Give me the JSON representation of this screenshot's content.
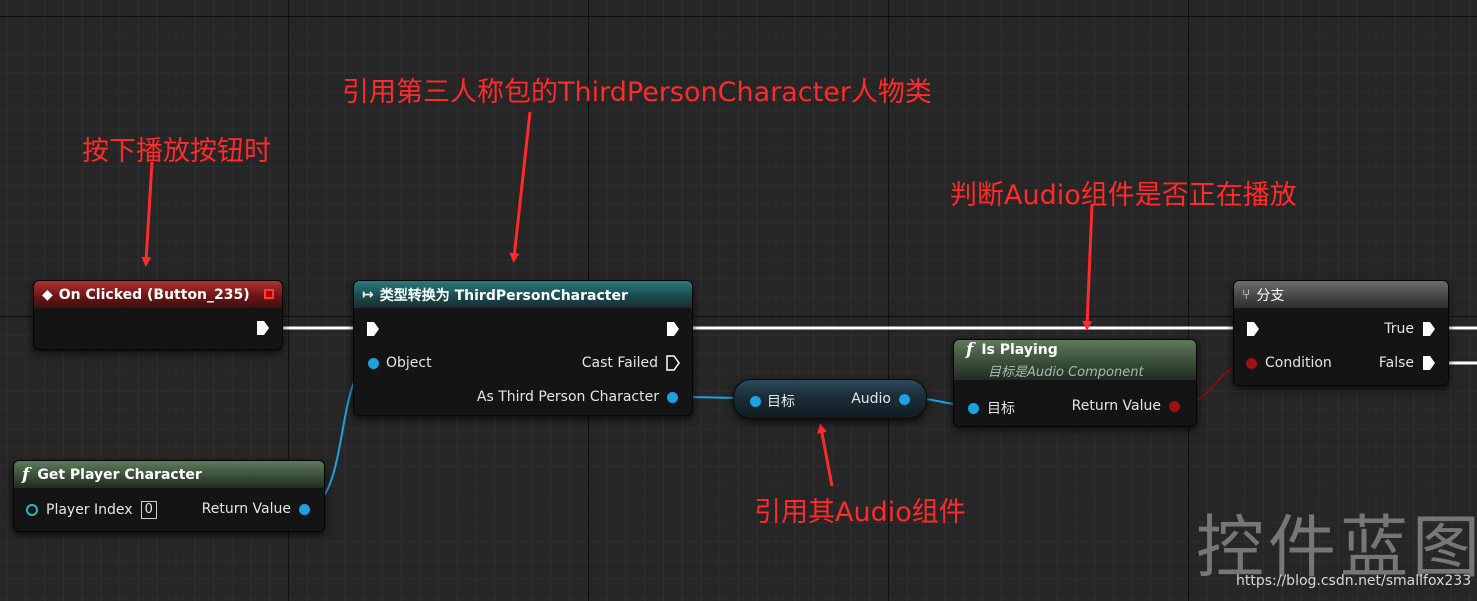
{
  "annotations": {
    "play_click": "按下播放按钮时",
    "cast_ref": "引用第三人称包的ThirdPersonCharacter人物类",
    "is_playing": "判断Audio组件是否正在播放",
    "audio_ref": "引用其Audio组件"
  },
  "nodes": {
    "on_clicked": {
      "title": "On Clicked (Button_235)"
    },
    "cast": {
      "title": "类型转换为 ThirdPersonCharacter",
      "object_pin": "Object",
      "cast_failed_pin": "Cast Failed",
      "as_pin": "As Third Person Character"
    },
    "get_player": {
      "title": "Get Player Character",
      "player_index_pin": "Player Index",
      "player_index_value": "0",
      "return_pin": "Return Value"
    },
    "audio_get": {
      "target_pin": "目标",
      "audio_pin": "Audio"
    },
    "is_playing": {
      "title": "Is Playing",
      "subtitle": "目标是Audio Component",
      "target_pin": "目标",
      "return_pin": "Return Value"
    },
    "branch": {
      "title": "分支",
      "condition_pin": "Condition",
      "true_pin": "True",
      "false_pin": "False"
    }
  },
  "watermark": "控件蓝图",
  "url_text": "https://blog.csdn.net/smallfox233",
  "colors": {
    "annotation": "#ff2a2a",
    "object_pin": "#1aa3e0",
    "bool_pin": "#a01010",
    "int_pin": "#2bb8c0",
    "exec_wire": "#ffffff"
  },
  "icons": {
    "event": "event-diamond-icon",
    "cast": "cast-arrows-icon",
    "function": "function-f-icon",
    "branch": "branch-icon",
    "delegate": "delegate-square-icon"
  }
}
